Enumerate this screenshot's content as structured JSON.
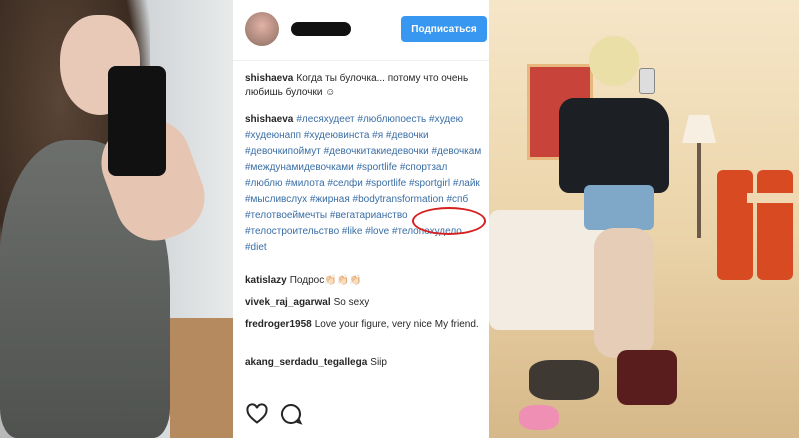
{
  "post": {
    "follow_button": "Подписаться",
    "caption": {
      "user": "shishaeva",
      "text": "Когда ты булочка... потому что очень любишь булочки ☺"
    },
    "tags_line": {
      "user": "shishaeva",
      "tags": "#лесяхудеет #люблюпоесть #худею #худеюнапп #худеювинста #я #девочки #девочкипоймут #девочкитакиедевочки #девочкам #междунамидевочками #sportlife #спортзал #люблю #милота #селфи #sportlife #sportgirl #лайк #мысливслух #жирная #bodytransformation #спб #телотвоеймечты #вегатарианство #телостроительство #like #love #телопохудело #diet"
    },
    "comments": [
      {
        "user": "katislazy",
        "text": "Подрос👏🏻👏🏻👏🏻"
      },
      {
        "user": "vivek_raj_agarwal",
        "text": "So sexy"
      },
      {
        "user": "fredroger1958",
        "text": "Love your figure, very nice My friend."
      },
      {
        "user": "akang_serdadu_tegallega",
        "text": "Siip"
      }
    ]
  },
  "icons": [
    "heart-icon",
    "comment-icon"
  ],
  "colors": {
    "follow": "#3897f0",
    "highlight_ring": "#d62020",
    "hashtag": "#3a6ea5"
  }
}
